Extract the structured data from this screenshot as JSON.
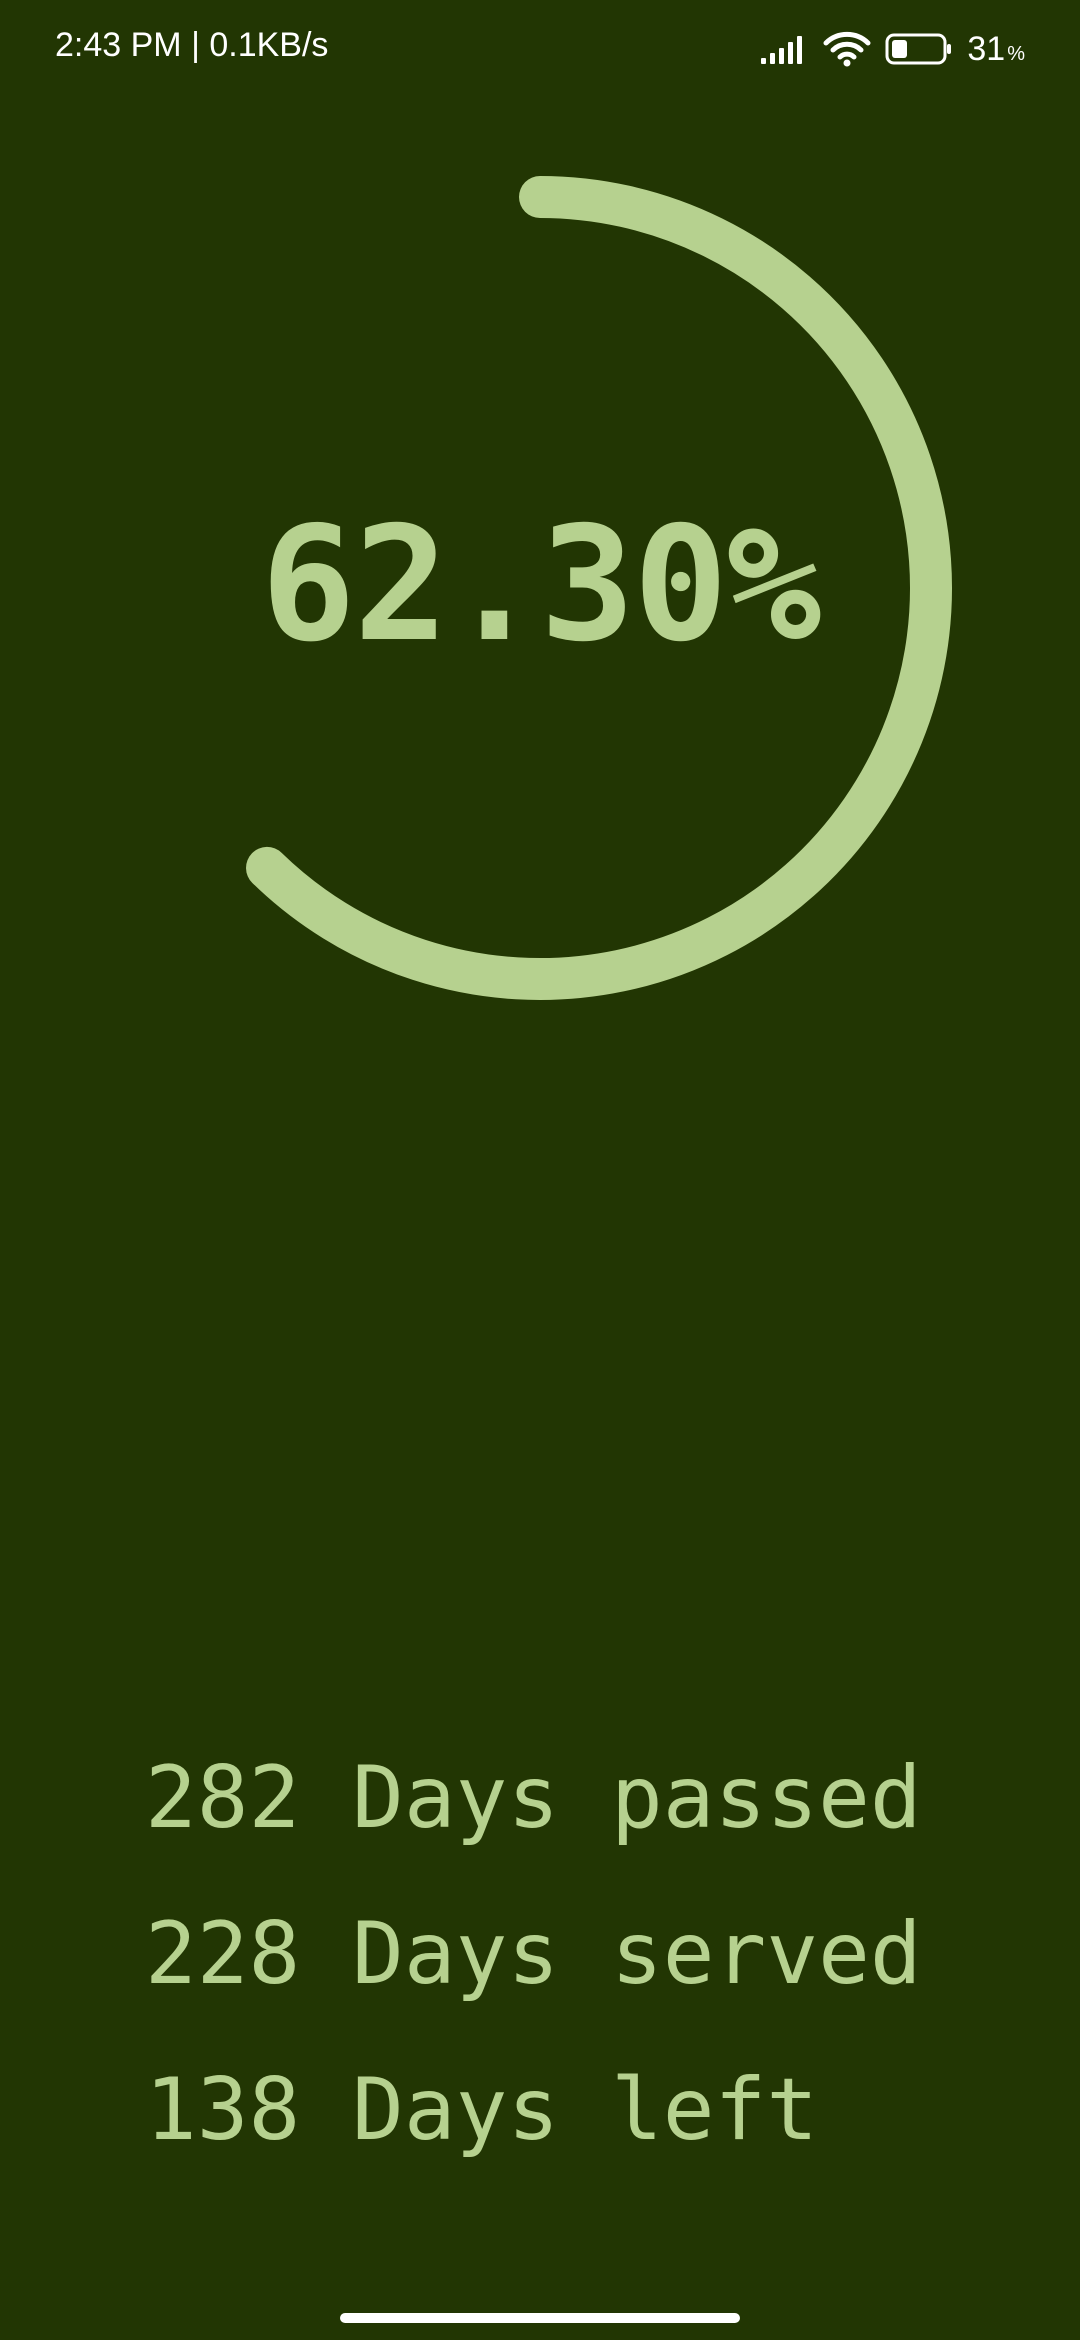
{
  "status_bar": {
    "time_speed": "2:43 PM | 0.1KB/s",
    "battery_level": "31",
    "battery_unit": "%",
    "icons": [
      "signal-icon",
      "wifi-icon",
      "battery-icon"
    ]
  },
  "progress": {
    "value": 0.623,
    "label": "62.30%",
    "ring_color": "#b6d18f",
    "background_color": "#223603"
  },
  "stats": [
    {
      "count": "282",
      "text": "Days passed"
    },
    {
      "count": "228",
      "text": "Days served"
    },
    {
      "count": "138",
      "text": "Days left"
    }
  ]
}
